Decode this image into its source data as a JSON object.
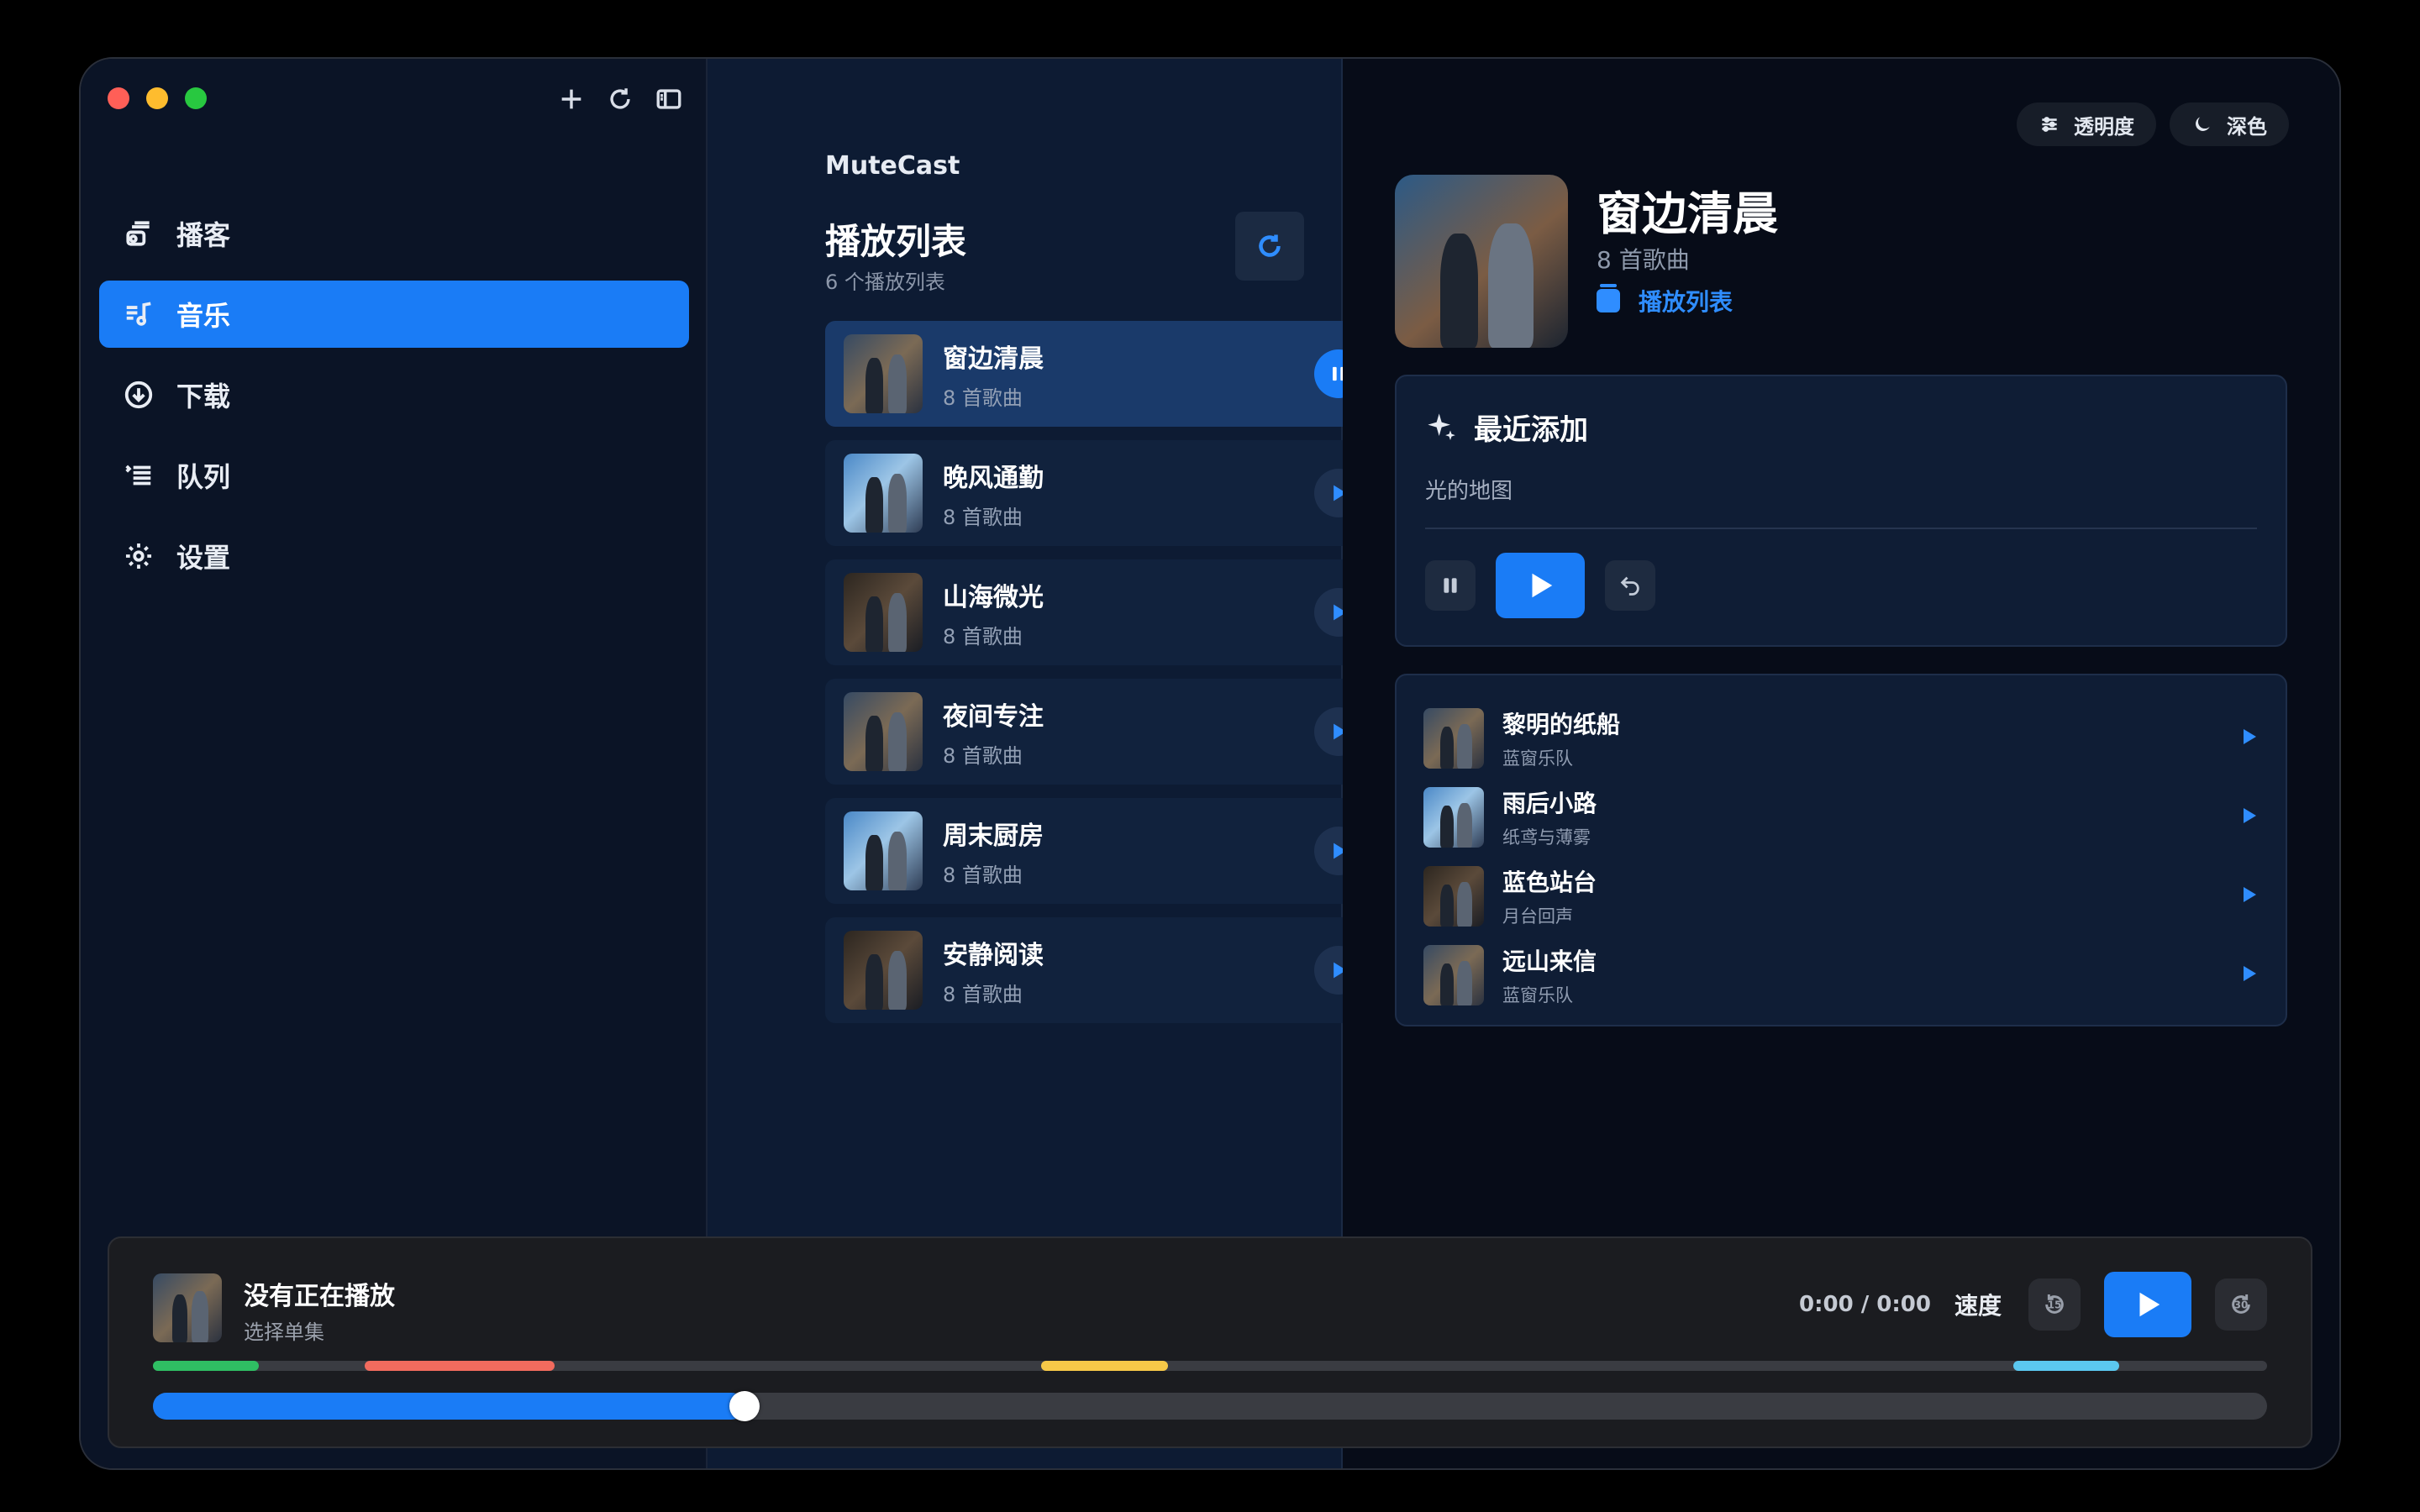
{
  "sidebar": {
    "items": [
      {
        "label": "播客",
        "icon": "podcast-icon",
        "active": false
      },
      {
        "label": "音乐",
        "icon": "music-icon",
        "active": true
      },
      {
        "label": "下载",
        "icon": "download-icon",
        "active": false
      },
      {
        "label": "队列",
        "icon": "queue-icon",
        "active": false
      },
      {
        "label": "设置",
        "icon": "gear-icon",
        "active": false
      }
    ]
  },
  "middle": {
    "brand": "MuteCast",
    "title": "播放列表",
    "count": "6 个播放列表",
    "playlists": [
      {
        "name": "窗边清晨",
        "sub": "8 首歌曲",
        "active": true
      },
      {
        "name": "晚风通勤",
        "sub": "8 首歌曲",
        "active": false
      },
      {
        "name": "山海微光",
        "sub": "8 首歌曲",
        "active": false
      },
      {
        "name": "夜间专注",
        "sub": "8 首歌曲",
        "active": false
      },
      {
        "name": "周末厨房",
        "sub": "8 首歌曲",
        "active": false
      },
      {
        "name": "安静阅读",
        "sub": "8 首歌曲",
        "active": false
      }
    ]
  },
  "detail": {
    "transparency_label": "透明度",
    "dark_label": "深色",
    "title": "窗边清晨",
    "sub": "8 首歌曲",
    "link": "播放列表",
    "recent": {
      "heading": "最近添加",
      "item": "光的地图"
    },
    "tracks": [
      {
        "name": "黎明的纸船",
        "artist": "蓝窗乐队"
      },
      {
        "name": "雨后小路",
        "artist": "纸鸢与薄雾"
      },
      {
        "name": "蓝色站台",
        "artist": "月台回声"
      },
      {
        "name": "远山来信",
        "artist": "蓝窗乐队"
      }
    ]
  },
  "player": {
    "title": "没有正在播放",
    "sub": "选择单集",
    "time": "0:00 / 0:00",
    "speed_label": "速度",
    "skip_back": "15",
    "skip_forward": "30",
    "progress": 0.28,
    "chapters": [
      {
        "start": 0.0,
        "end": 0.05,
        "color": "#2fbe63"
      },
      {
        "start": 0.1,
        "end": 0.19,
        "color": "#f26b5e"
      },
      {
        "start": 0.42,
        "end": 0.48,
        "color": "#f7c948"
      },
      {
        "start": 0.88,
        "end": 0.93,
        "color": "#5bc8f0"
      }
    ]
  },
  "colors": {
    "accent": "#1a7cf6"
  }
}
